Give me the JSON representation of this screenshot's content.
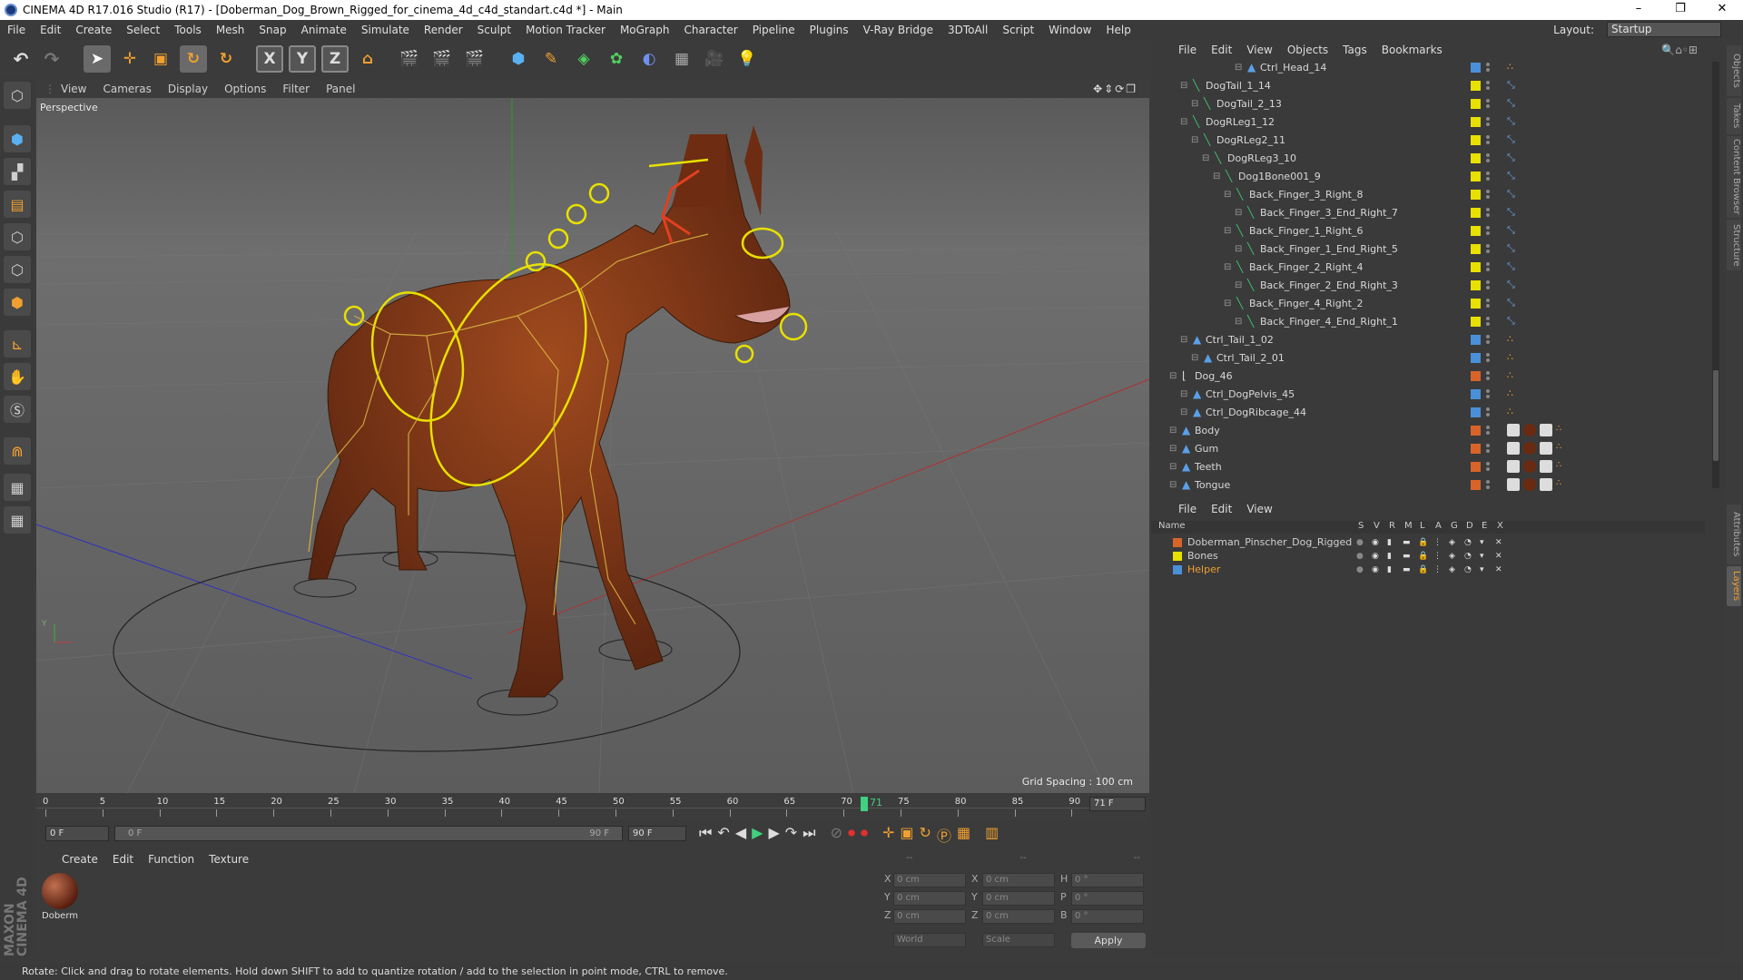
{
  "window": {
    "title": "CINEMA 4D R17.016 Studio (R17) - [Doberman_Dog_Brown_Rigged_for_cinema_4d_c4d_standart.c4d *] - Main",
    "minimize": "–",
    "restore": "❐",
    "close": "✕"
  },
  "menubar": {
    "items": [
      "File",
      "Edit",
      "Create",
      "Select",
      "Tools",
      "Mesh",
      "Snap",
      "Animate",
      "Simulate",
      "Render",
      "Sculpt",
      "Motion Tracker",
      "MoGraph",
      "Character",
      "Pipeline",
      "Plugins",
      "V-Ray Bridge",
      "3DToAll",
      "Script",
      "Window",
      "Help"
    ],
    "layout_label": "Layout:",
    "layout_value": "Startup"
  },
  "viewport": {
    "menu": [
      "View",
      "Cameras",
      "Display",
      "Options",
      "Filter",
      "Panel"
    ],
    "label": "Perspective",
    "grid_spacing": "Grid Spacing : 100 cm"
  },
  "timeline": {
    "ticks": [
      "0",
      "5",
      "10",
      "15",
      "20",
      "25",
      "30",
      "35",
      "40",
      "45",
      "50",
      "55",
      "60",
      "65",
      "70",
      "75",
      "80",
      "85",
      "90"
    ],
    "current": "71",
    "current_display": "71 F"
  },
  "transport": {
    "start": "0 F",
    "range_start": "0 F",
    "range_end": "90 F",
    "end": "90 F"
  },
  "materials": {
    "menu": [
      "Create",
      "Edit",
      "Function",
      "Texture"
    ],
    "items": [
      {
        "name": "Doberm"
      }
    ]
  },
  "coords": {
    "headers": [
      "--",
      "--",
      "--"
    ],
    "rows": [
      {
        "a": "X",
        "av": "0 cm",
        "b": "X",
        "bv": "0 cm",
        "c": "H",
        "cv": "0 °"
      },
      {
        "a": "Y",
        "av": "0 cm",
        "b": "Y",
        "bv": "0 cm",
        "c": "P",
        "cv": "0 °"
      },
      {
        "a": "Z",
        "av": "0 cm",
        "b": "Z",
        "bv": "0 cm",
        "c": "B",
        "cv": "0 °"
      }
    ],
    "world": "World",
    "scale": "Scale",
    "apply": "Apply"
  },
  "objects": {
    "menu": [
      "File",
      "Edit",
      "View",
      "Objects",
      "Tags",
      "Bookmarks"
    ],
    "rows": [
      {
        "name": "Ctrl_Head_14",
        "indent": 6,
        "color": "#4a90d9",
        "icon": "null"
      },
      {
        "name": "DogTail_1_14",
        "indent": 1,
        "color": "#e8e000",
        "icon": "bone"
      },
      {
        "name": "DogTail_2_13",
        "indent": 2,
        "color": "#e8e000",
        "icon": "bone"
      },
      {
        "name": "DogRLeg1_12",
        "indent": 1,
        "color": "#e8e000",
        "icon": "bone"
      },
      {
        "name": "DogRLeg2_11",
        "indent": 2,
        "color": "#e8e000",
        "icon": "bone"
      },
      {
        "name": "DogRLeg3_10",
        "indent": 3,
        "color": "#e8e000",
        "icon": "bone"
      },
      {
        "name": "Dog1Bone001_9",
        "indent": 4,
        "color": "#e8e000",
        "icon": "bone"
      },
      {
        "name": "Back_Finger_3_Right_8",
        "indent": 5,
        "color": "#e8e000",
        "icon": "bone"
      },
      {
        "name": "Back_Finger_3_End_Right_7",
        "indent": 6,
        "color": "#e8e000",
        "icon": "bone"
      },
      {
        "name": "Back_Finger_1_Right_6",
        "indent": 5,
        "color": "#e8e000",
        "icon": "bone"
      },
      {
        "name": "Back_Finger_1_End_Right_5",
        "indent": 6,
        "color": "#e8e000",
        "icon": "bone"
      },
      {
        "name": "Back_Finger_2_Right_4",
        "indent": 5,
        "color": "#e8e000",
        "icon": "bone"
      },
      {
        "name": "Back_Finger_2_End_Right_3",
        "indent": 6,
        "color": "#e8e000",
        "icon": "bone"
      },
      {
        "name": "Back_Finger_4_Right_2",
        "indent": 5,
        "color": "#e8e000",
        "icon": "bone"
      },
      {
        "name": "Back_Finger_4_End_Right_1",
        "indent": 6,
        "color": "#e8e000",
        "icon": "bone"
      },
      {
        "name": "Ctrl_Tail_1_02",
        "indent": 1,
        "color": "#4a90d9",
        "icon": "null"
      },
      {
        "name": "Ctrl_Tail_2_01",
        "indent": 2,
        "color": "#4a90d9",
        "icon": "null"
      },
      {
        "name": "Dog_46",
        "indent": 0,
        "color": "#d8642a",
        "icon": "layer"
      },
      {
        "name": "Ctrl_DogPelvis_45",
        "indent": 1,
        "color": "#4a90d9",
        "icon": "null"
      },
      {
        "name": "Ctrl_DogRibcage_44",
        "indent": 1,
        "color": "#4a90d9",
        "icon": "null"
      },
      {
        "name": "Body",
        "indent": 0,
        "color": "#d8642a",
        "icon": "null"
      },
      {
        "name": "Gum",
        "indent": 0,
        "color": "#d8642a",
        "icon": "null"
      },
      {
        "name": "Teeth",
        "indent": 0,
        "color": "#d8642a",
        "icon": "null"
      },
      {
        "name": "Tongue",
        "indent": 0,
        "color": "#d8642a",
        "icon": "null"
      }
    ]
  },
  "layers": {
    "menu": [
      "File",
      "Edit",
      "View"
    ],
    "header": {
      "name": "Name",
      "cols": [
        "S",
        "V",
        "R",
        "M",
        "L",
        "A",
        "G",
        "D",
        "E",
        "X"
      ]
    },
    "rows": [
      {
        "name": "Doberman_Pinscher_Dog_Rigged",
        "color": "#d8642a",
        "text_color": "#d0d0d0"
      },
      {
        "name": "Bones",
        "color": "#e8e000",
        "text_color": "#d0d0d0"
      },
      {
        "name": "Helper",
        "color": "#4a90d9",
        "text_color": "#f0a030"
      }
    ]
  },
  "side_tabs_top": [
    "Objects",
    "Takes",
    "Content Browser",
    "Structure"
  ],
  "side_tabs_bottom": [
    "Attributes",
    "Layers"
  ],
  "brand": "MAXON CINEMA 4D",
  "status": "Rotate: Click and drag to rotate elements. Hold down SHIFT to add to quantize rotation / add to the selection in point mode, CTRL to remove."
}
